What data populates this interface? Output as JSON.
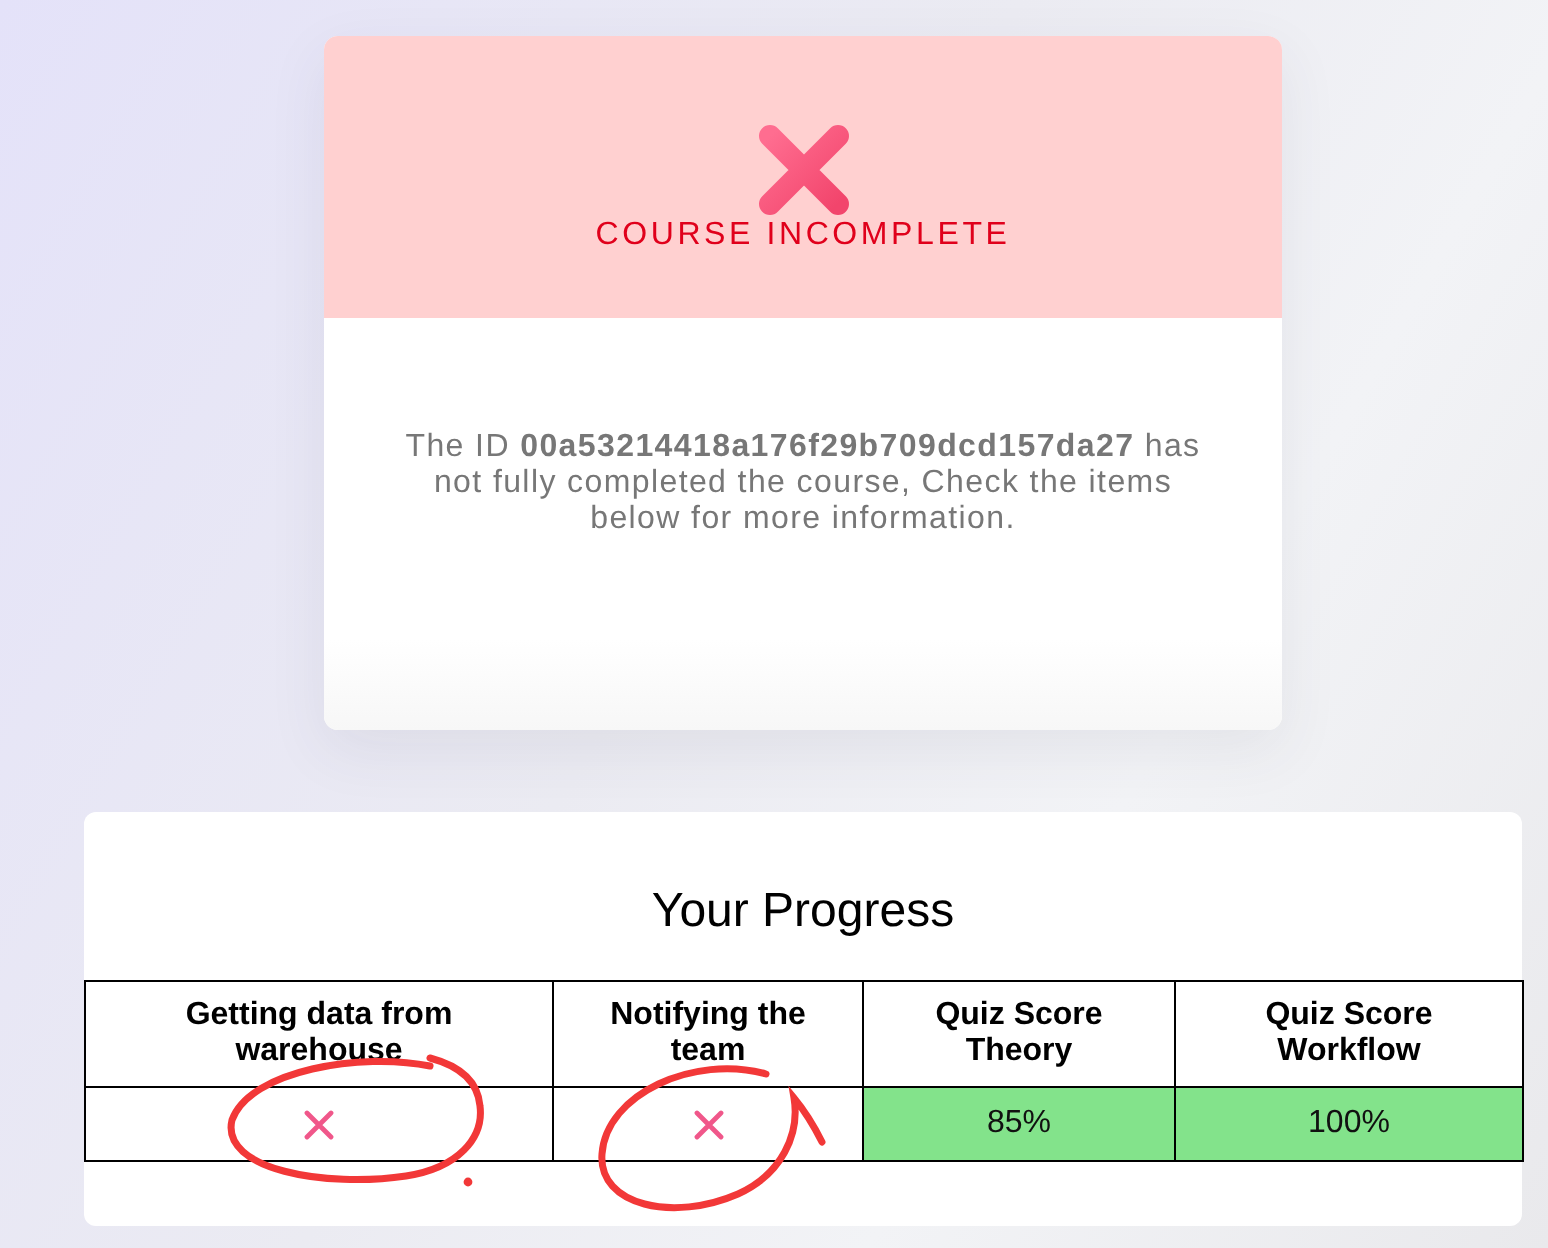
{
  "status": {
    "title": "COURSE INCOMPLETE",
    "passed": false
  },
  "message": "The ID **00a53214418a176f29b709dcd157da27** has not fully completed the course, Check the items below for more information.",
  "progress": {
    "title": "Your Progress",
    "columns": [
      "Getting data from warehouse",
      "Notifying the team",
      "Quiz Score Theory",
      "Quiz Score Workflow"
    ],
    "cells": [
      {
        "kind": "mark",
        "passed": false,
        "circled": true
      },
      {
        "kind": "mark",
        "passed": false,
        "circled": true
      },
      {
        "kind": "score",
        "text": "85%",
        "passed": true,
        "circled": false
      },
      {
        "kind": "score",
        "text": "100%",
        "passed": true,
        "circled": false
      }
    ]
  }
}
